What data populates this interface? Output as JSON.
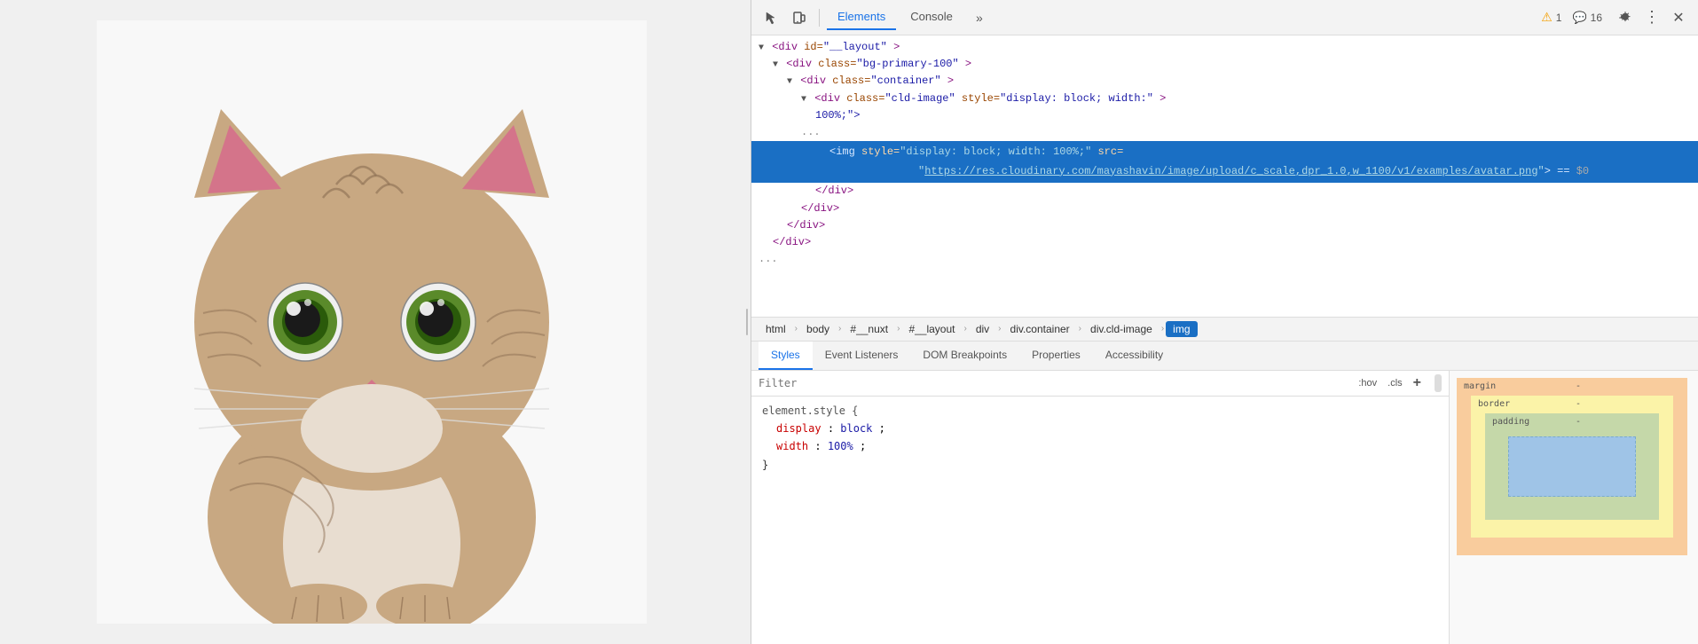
{
  "layout": {
    "left_panel": {
      "cat_description": "A tabby cat with green eyes looking straight at the camera against a white background"
    },
    "devtools": {
      "toolbar": {
        "inspect_icon": "cursor-icon",
        "device_icon": "device-toolbar-icon",
        "tabs": [
          {
            "label": "Elements",
            "active": true
          },
          {
            "label": "Console",
            "active": false
          }
        ],
        "more_tabs_icon": "chevron-right-icon",
        "warning_count": "1",
        "message_count": "16",
        "settings_icon": "gear-icon",
        "more_options_icon": "ellipsis-icon",
        "close_icon": "close-icon"
      },
      "html_tree": {
        "lines": [
          {
            "indent": 1,
            "content": "<div id=\"__layout\">",
            "id": "line-layout"
          },
          {
            "indent": 2,
            "content": "<div class=\"bg-primary-100\">",
            "id": "line-bg"
          },
          {
            "indent": 3,
            "content": "<div class=\"container\">",
            "id": "line-container"
          },
          {
            "indent": 4,
            "content": "<div class=\"cld-image\" style=\"display: block; width: 100%;\">",
            "id": "line-cld-image",
            "has_children": true
          },
          {
            "indent": 5,
            "content": "100%;\">",
            "id": "line-100percent"
          },
          {
            "indent": 6,
            "content": "img_selected",
            "id": "line-img",
            "selected": true
          },
          {
            "indent": 5,
            "content": "</div>",
            "id": "line-close-div1"
          },
          {
            "indent": 4,
            "content": "</div>",
            "id": "line-close-div2"
          },
          {
            "indent": 3,
            "content": "</div>",
            "id": "line-close-div3"
          },
          {
            "indent": 2,
            "content": "</div>",
            "id": "line-close-div4"
          },
          {
            "indent": 1,
            "content": "...",
            "id": "line-ellipsis"
          }
        ],
        "selected_line": {
          "indent": 6,
          "img_tag_start": "<img style=\"display: block; width: 100%;\" src=",
          "img_src_url": "https://res.cloudinary.com/mayashavin/image/upload/c_scale,dpr_1.0,w_1100/v1/examples/avatar.png",
          "img_tag_end": "\"> == $0"
        }
      },
      "breadcrumbs": [
        {
          "label": "html",
          "active": false
        },
        {
          "label": "body",
          "active": false
        },
        {
          "label": "#__nuxt",
          "active": false
        },
        {
          "label": "#__layout",
          "active": false
        },
        {
          "label": "div",
          "active": false
        },
        {
          "label": "div.container",
          "active": false
        },
        {
          "label": "div.cld-image",
          "active": false
        },
        {
          "label": "img",
          "active": true
        }
      ],
      "bottom_tabs": [
        {
          "label": "Styles",
          "active": true
        },
        {
          "label": "Event Listeners",
          "active": false
        },
        {
          "label": "DOM Breakpoints",
          "active": false
        },
        {
          "label": "Properties",
          "active": false
        },
        {
          "label": "Accessibility",
          "active": false
        }
      ],
      "styles_panel": {
        "filter_placeholder": "Filter",
        "filter_hov_label": ":hov",
        "filter_cls_label": ".cls",
        "filter_add_label": "+",
        "element_style": {
          "selector": "element.style {",
          "properties": [
            {
              "name": "display",
              "value": "block"
            },
            {
              "name": "width",
              "value": "100%"
            }
          ],
          "close": "}"
        }
      },
      "box_model": {
        "margin_label": "margin",
        "border_label": "border",
        "padding_label": "padding",
        "margin_value": "-",
        "border_value": "-",
        "padding_value": "-"
      }
    }
  }
}
